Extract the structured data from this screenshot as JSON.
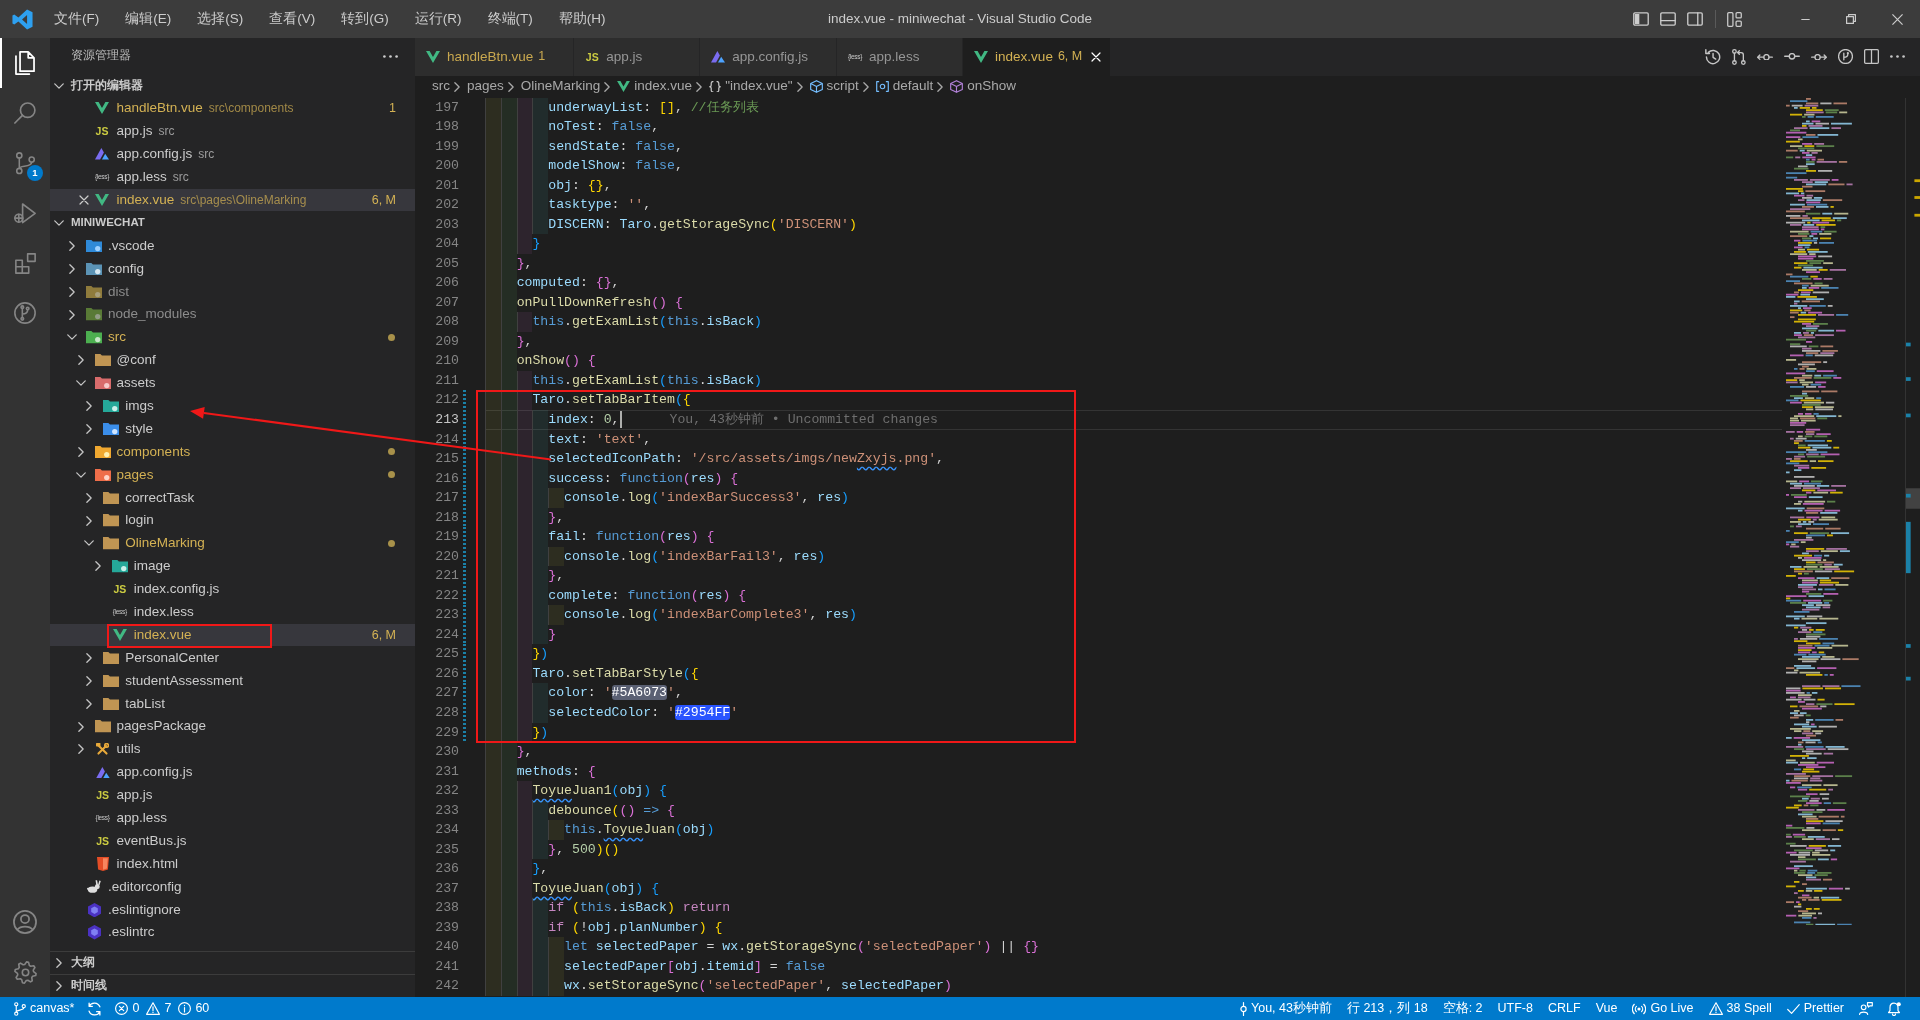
{
  "window": {
    "title": "index.vue - miniwechat - Visual Studio Code"
  },
  "menu": [
    "文件(F)",
    "编辑(E)",
    "选择(S)",
    "查看(V)",
    "转到(G)",
    "运行(R)",
    "终端(T)",
    "帮助(H)"
  ],
  "layout_controls": [
    {
      "kind": "sidebar"
    },
    {
      "kind": "panel"
    },
    {
      "kind": "auxbar"
    },
    {
      "kind": "customize"
    }
  ],
  "window_controls": [
    {
      "kind": "minimize"
    },
    {
      "kind": "restore"
    },
    {
      "kind": "close"
    }
  ],
  "activity_bar": {
    "top": [
      {
        "kind": "explorer",
        "selected": true
      },
      {
        "kind": "search",
        "selected": false
      },
      {
        "kind": "scm",
        "selected": false,
        "badge": "1"
      },
      {
        "kind": "debug",
        "selected": false
      },
      {
        "kind": "extensions",
        "selected": false
      },
      {
        "kind": "gitgraph",
        "selected": false
      }
    ],
    "bottom": [
      {
        "kind": "account"
      },
      {
        "kind": "settings"
      }
    ]
  },
  "sidebar": {
    "title": "资源管理器",
    "open_editors": {
      "title": "打开的编辑器",
      "expanded": true,
      "items": [
        {
          "label": "handleBtn.vue",
          "path": "src\\components",
          "badge": "1",
          "kind": "vue",
          "warning": true,
          "selected": false
        },
        {
          "label": "app.js",
          "path": "src",
          "kind": "js",
          "icon_text": "JS",
          "warning": false,
          "selected": false
        },
        {
          "label": "app.config.js",
          "path": "src",
          "kind": "appconfig",
          "warning": false,
          "selected": false
        },
        {
          "label": "app.less",
          "path": "src",
          "kind": "less",
          "icon_text": "{less}",
          "warning": false,
          "selected": false
        },
        {
          "label": "index.vue",
          "path": "src\\pages\\OlineMarking",
          "badge": "6, M",
          "kind": "vue",
          "warning": true,
          "selected": true
        }
      ]
    },
    "folder": {
      "title": "MINIWECHAT",
      "expanded": true,
      "items": [
        {
          "label": ".vscode",
          "kind": "vscode",
          "expanded": false,
          "modified": false,
          "ignored": false,
          "selected": false
        },
        {
          "label": "config",
          "kind": "config",
          "expanded": false,
          "modified": false,
          "ignored": false,
          "selected": false
        },
        {
          "label": "dist",
          "kind": "dist",
          "expanded": false,
          "modified": false,
          "ignored": true,
          "selected": false
        },
        {
          "label": "node_modules",
          "kind": "node",
          "expanded": false,
          "modified": false,
          "ignored": true,
          "selected": false
        },
        {
          "label": "src",
          "kind": "src",
          "expanded": true,
          "modified": true,
          "ignored": false,
          "selected": false,
          "children": [
            {
              "label": "@conf",
              "kind": "folder",
              "expanded": false,
              "modified": false,
              "ignored": false,
              "selected": false
            },
            {
              "label": "assets",
              "kind": "assets",
              "expanded": true,
              "modified": false,
              "ignored": false,
              "selected": false,
              "children": [
                {
                  "label": "imgs",
                  "kind": "images",
                  "expanded": false,
                  "modified": false,
                  "ignored": false,
                  "selected": false
                },
                {
                  "label": "style",
                  "kind": "style",
                  "expanded": false,
                  "modified": false,
                  "ignored": false,
                  "selected": false
                }
              ]
            },
            {
              "label": "components",
              "kind": "components",
              "expanded": false,
              "modified": true,
              "ignored": false,
              "selected": false
            },
            {
              "label": "pages",
              "kind": "pages",
              "expanded": true,
              "modified": true,
              "ignored": false,
              "selected": false,
              "children": [
                {
                  "label": "correctTask",
                  "kind": "folder",
                  "expanded": false,
                  "modified": false,
                  "ignored": false,
                  "selected": false
                },
                {
                  "label": "login",
                  "kind": "folder",
                  "expanded": false,
                  "modified": false,
                  "ignored": false,
                  "selected": false
                },
                {
                  "label": "OlineMarking",
                  "kind": "folder",
                  "expanded": true,
                  "modified": true,
                  "ignored": false,
                  "selected": false,
                  "children": [
                    {
                      "label": "image",
                      "kind": "images",
                      "expanded": false,
                      "modified": false,
                      "ignored": false,
                      "selected": false
                    },
                    {
                      "label": "index.config.js",
                      "kind": "js",
                      "icon_text": "JS",
                      "modified": false,
                      "ignored": false,
                      "selected": false
                    },
                    {
                      "label": "index.less",
                      "kind": "less",
                      "icon_text": "{less}",
                      "modified": false,
                      "ignored": false,
                      "selected": false
                    },
                    {
                      "label": "index.vue",
                      "kind": "vue",
                      "badge": "6, M",
                      "modified": true,
                      "ignored": false,
                      "selected": true
                    }
                  ]
                },
                {
                  "label": "PersonalCenter",
                  "kind": "folder",
                  "expanded": false,
                  "modified": false,
                  "ignored": false,
                  "selected": false
                },
                {
                  "label": "studentAssessment",
                  "kind": "folder",
                  "expanded": false,
                  "modified": false,
                  "ignored": false,
                  "selected": false
                },
                {
                  "label": "tabList",
                  "kind": "folder",
                  "expanded": false,
                  "modified": false,
                  "ignored": false,
                  "selected": false
                }
              ]
            },
            {
              "label": "pagesPackage",
              "kind": "folder",
              "expanded": false,
              "modified": false,
              "ignored": false,
              "selected": false
            },
            {
              "label": "utils",
              "kind": "utils",
              "expanded": false,
              "modified": false,
              "ignored": false,
              "selected": false
            },
            {
              "label": "app.config.js",
              "kind": "appconfig",
              "modified": false,
              "ignored": false,
              "selected": false
            },
            {
              "label": "app.js",
              "kind": "js",
              "icon_text": "JS",
              "modified": false,
              "ignored": false,
              "selected": false
            },
            {
              "label": "app.less",
              "kind": "less",
              "icon_text": "{less}",
              "modified": false,
              "ignored": false,
              "selected": false
            },
            {
              "label": "eventBus.js",
              "kind": "js",
              "icon_text": "JS",
              "modified": false,
              "ignored": false,
              "selected": false
            },
            {
              "label": "index.html",
              "kind": "html",
              "modified": false,
              "ignored": false,
              "selected": false
            }
          ]
        },
        {
          "label": ".editorconfig",
          "kind": "editorconfig",
          "modified": false,
          "ignored": false,
          "selected": false
        },
        {
          "label": ".eslintignore",
          "kind": "eslint",
          "modified": false,
          "ignored": false,
          "selected": false
        },
        {
          "label": ".eslintrc",
          "kind": "eslint",
          "modified": false,
          "ignored": false,
          "selected": false
        }
      ]
    },
    "panels": [
      {
        "title": "大纲",
        "expanded": false
      },
      {
        "title": "时间线",
        "expanded": false
      }
    ]
  },
  "editor": {
    "tabs": [
      {
        "label": "handleBtn.vue",
        "kind": "vue",
        "badge": "1",
        "warning": true,
        "selected": false
      },
      {
        "label": "app.js",
        "kind": "js",
        "icon_text": "JS",
        "warning": false,
        "selected": false
      },
      {
        "label": "app.config.js",
        "kind": "appconfig",
        "warning": false,
        "selected": false
      },
      {
        "label": "app.less",
        "kind": "less",
        "icon_text": "{less}",
        "warning": false,
        "selected": false
      },
      {
        "label": "index.vue",
        "kind": "vue",
        "badge": "6, M",
        "warning": true,
        "selected": true
      }
    ],
    "actions": [
      {
        "kind": "history"
      },
      {
        "kind": "compare"
      },
      {
        "kind": "prevchange"
      },
      {
        "kind": "commit"
      },
      {
        "kind": "nextchange"
      },
      {
        "kind": "gitlens"
      },
      {
        "kind": "split"
      },
      {
        "kind": "more"
      }
    ],
    "breadcrumb": [
      {
        "text": "src",
        "kind": "folder"
      },
      {
        "text": "pages",
        "kind": "folder"
      },
      {
        "text": "OlineMarking",
        "kind": "folder"
      },
      {
        "text": "index.vue",
        "kind": "vue"
      },
      {
        "text": "\"index.vue\"",
        "kind": "object"
      },
      {
        "text": "script",
        "kind": "module"
      },
      {
        "text": "default",
        "kind": "variable"
      },
      {
        "text": "onShow",
        "kind": "method"
      }
    ],
    "lines": [
      {
        "number": "197",
        "modified": false,
        "current": false,
        "tokens": [
          {
            "text": "        underwayList",
            "kind": "prop"
          },
          {
            "text": ": ",
            "kind": "plain"
          },
          {
            "text": "[]",
            "kind": "bracket1"
          },
          {
            "text": ", ",
            "kind": "plain"
          },
          {
            "text": "//任务列表",
            "kind": "comment"
          }
        ]
      },
      {
        "number": "198",
        "modified": false,
        "current": false,
        "tokens": [
          {
            "text": "        noTest",
            "kind": "prop"
          },
          {
            "text": ": ",
            "kind": "plain"
          },
          {
            "text": "false",
            "kind": "keyword"
          },
          {
            "text": ",",
            "kind": "plain"
          }
        ]
      },
      {
        "number": "199",
        "modified": false,
        "current": false,
        "tokens": [
          {
            "text": "        sendState",
            "kind": "prop"
          },
          {
            "text": ": ",
            "kind": "plain"
          },
          {
            "text": "false",
            "kind": "keyword"
          },
          {
            "text": ",",
            "kind": "plain"
          }
        ]
      },
      {
        "number": "200",
        "modified": false,
        "current": false,
        "tokens": [
          {
            "text": "        modelShow",
            "kind": "prop"
          },
          {
            "text": ": ",
            "kind": "plain"
          },
          {
            "text": "false",
            "kind": "keyword"
          },
          {
            "text": ",",
            "kind": "plain"
          }
        ]
      },
      {
        "number": "201",
        "modified": false,
        "current": false,
        "tokens": [
          {
            "text": "        obj",
            "kind": "prop"
          },
          {
            "text": ": ",
            "kind": "plain"
          },
          {
            "text": "{}",
            "kind": "bracket1"
          },
          {
            "text": ",",
            "kind": "plain"
          }
        ]
      },
      {
        "number": "202",
        "modified": false,
        "current": false,
        "tokens": [
          {
            "text": "        tasktype",
            "kind": "prop"
          },
          {
            "text": ": ",
            "kind": "plain"
          },
          {
            "text": "''",
            "kind": "string"
          },
          {
            "text": ",",
            "kind": "plain"
          }
        ]
      },
      {
        "number": "203",
        "modified": false,
        "current": false,
        "tokens": [
          {
            "text": "        DISCERN",
            "kind": "prop"
          },
          {
            "text": ": ",
            "kind": "plain"
          },
          {
            "text": "Taro",
            "kind": "prop"
          },
          {
            "text": ".",
            "kind": "plain"
          },
          {
            "text": "getStorageSync",
            "kind": "func"
          },
          {
            "text": "(",
            "kind": "bracket1"
          },
          {
            "text": "'DISCERN'",
            "kind": "string"
          },
          {
            "text": ")",
            "kind": "bracket1"
          }
        ]
      },
      {
        "number": "204",
        "modified": false,
        "current": false,
        "tokens": [
          {
            "text": "      }",
            "kind": "bracket3"
          }
        ]
      },
      {
        "number": "205",
        "modified": false,
        "current": false,
        "tokens": [
          {
            "text": "    }",
            "kind": "bracket2"
          },
          {
            "text": ",",
            "kind": "plain"
          }
        ]
      },
      {
        "number": "206",
        "modified": false,
        "current": false,
        "tokens": [
          {
            "text": "    computed",
            "kind": "prop"
          },
          {
            "text": ": ",
            "kind": "plain"
          },
          {
            "text": "{}",
            "kind": "bracket2"
          },
          {
            "text": ",",
            "kind": "plain"
          }
        ]
      },
      {
        "number": "207",
        "modified": false,
        "current": false,
        "tokens": [
          {
            "text": "    onPullDownRefresh",
            "kind": "func"
          },
          {
            "text": "() {",
            "kind": "bracket2"
          }
        ]
      },
      {
        "number": "208",
        "modified": false,
        "current": false,
        "tokens": [
          {
            "text": "      this",
            "kind": "keyword"
          },
          {
            "text": ".",
            "kind": "plain"
          },
          {
            "text": "getExamList",
            "kind": "func"
          },
          {
            "text": "(",
            "kind": "bracket3"
          },
          {
            "text": "this",
            "kind": "keyword"
          },
          {
            "text": ".",
            "kind": "plain"
          },
          {
            "text": "isBack",
            "kind": "prop"
          },
          {
            "text": ")",
            "kind": "bracket3"
          }
        ]
      },
      {
        "number": "209",
        "modified": false,
        "current": false,
        "tokens": [
          {
            "text": "    }",
            "kind": "bracket2"
          },
          {
            "text": ",",
            "kind": "plain"
          }
        ]
      },
      {
        "number": "210",
        "modified": false,
        "current": false,
        "tokens": [
          {
            "text": "    onShow",
            "kind": "func"
          },
          {
            "text": "() {",
            "kind": "bracket2"
          }
        ]
      },
      {
        "number": "211",
        "modified": false,
        "current": false,
        "tokens": [
          {
            "text": "      this",
            "kind": "keyword"
          },
          {
            "text": ".",
            "kind": "plain"
          },
          {
            "text": "getExamList",
            "kind": "func"
          },
          {
            "text": "(",
            "kind": "bracket3"
          },
          {
            "text": "this",
            "kind": "keyword"
          },
          {
            "text": ".",
            "kind": "plain"
          },
          {
            "text": "isBack",
            "kind": "prop"
          },
          {
            "text": ")",
            "kind": "bracket3"
          }
        ]
      },
      {
        "number": "212",
        "modified": true,
        "current": false,
        "tokens": [
          {
            "text": "      Taro",
            "kind": "prop"
          },
          {
            "text": ".",
            "kind": "plain"
          },
          {
            "text": "setTabBarItem",
            "kind": "func"
          },
          {
            "text": "(",
            "kind": "bracket3"
          },
          {
            "text": "{",
            "kind": "bracket1"
          }
        ]
      },
      {
        "number": "213",
        "modified": true,
        "current": true,
        "blame": "You, 43秒钟前 • Uncommitted changes",
        "tokens": [
          {
            "text": "        index",
            "kind": "prop"
          },
          {
            "text": ": ",
            "kind": "plain"
          },
          {
            "text": "0",
            "kind": "number"
          },
          {
            "text": ",",
            "kind": "plain"
          }
        ]
      },
      {
        "number": "214",
        "modified": true,
        "current": false,
        "tokens": [
          {
            "text": "        text",
            "kind": "prop"
          },
          {
            "text": ": ",
            "kind": "plain"
          },
          {
            "text": "'text'",
            "kind": "string"
          },
          {
            "text": ",",
            "kind": "plain"
          }
        ]
      },
      {
        "number": "215",
        "modified": true,
        "current": false,
        "tokens": [
          {
            "text": "        selectedIconPath",
            "kind": "prop"
          },
          {
            "text": ": ",
            "kind": "plain"
          },
          {
            "text": "'/src/assets/imgs/new",
            "kind": "string"
          },
          {
            "text": "Zxyjs",
            "kind": "stringtypo"
          },
          {
            "text": ".png'",
            "kind": "string"
          },
          {
            "text": ",",
            "kind": "plain"
          }
        ]
      },
      {
        "number": "216",
        "modified": true,
        "current": false,
        "tokens": [
          {
            "text": "        success",
            "kind": "prop"
          },
          {
            "text": ": ",
            "kind": "plain"
          },
          {
            "text": "function",
            "kind": "keyword"
          },
          {
            "text": "(",
            "kind": "bracket2"
          },
          {
            "text": "res",
            "kind": "prop"
          },
          {
            "text": ") {",
            "kind": "bracket2"
          }
        ]
      },
      {
        "number": "217",
        "modified": true,
        "current": false,
        "tokens": [
          {
            "text": "          console",
            "kind": "prop"
          },
          {
            "text": ".",
            "kind": "plain"
          },
          {
            "text": "log",
            "kind": "func"
          },
          {
            "text": "(",
            "kind": "bracket3"
          },
          {
            "text": "'indexBarSuccess3'",
            "kind": "string"
          },
          {
            "text": ", ",
            "kind": "plain"
          },
          {
            "text": "res",
            "kind": "prop"
          },
          {
            "text": ")",
            "kind": "bracket3"
          }
        ]
      },
      {
        "number": "218",
        "modified": true,
        "current": false,
        "tokens": [
          {
            "text": "        }",
            "kind": "bracket2"
          },
          {
            "text": ",",
            "kind": "plain"
          }
        ]
      },
      {
        "number": "219",
        "modified": true,
        "current": false,
        "tokens": [
          {
            "text": "        fail",
            "kind": "prop"
          },
          {
            "text": ": ",
            "kind": "plain"
          },
          {
            "text": "function",
            "kind": "keyword"
          },
          {
            "text": "(",
            "kind": "bracket2"
          },
          {
            "text": "res",
            "kind": "prop"
          },
          {
            "text": ") {",
            "kind": "bracket2"
          }
        ]
      },
      {
        "number": "220",
        "modified": true,
        "current": false,
        "tokens": [
          {
            "text": "          console",
            "kind": "prop"
          },
          {
            "text": ".",
            "kind": "plain"
          },
          {
            "text": "log",
            "kind": "func"
          },
          {
            "text": "(",
            "kind": "bracket3"
          },
          {
            "text": "'indexBarFail3'",
            "kind": "string"
          },
          {
            "text": ", ",
            "kind": "plain"
          },
          {
            "text": "res",
            "kind": "prop"
          },
          {
            "text": ")",
            "kind": "bracket3"
          }
        ]
      },
      {
        "number": "221",
        "modified": true,
        "current": false,
        "tokens": [
          {
            "text": "        }",
            "kind": "bracket2"
          },
          {
            "text": ",",
            "kind": "plain"
          }
        ]
      },
      {
        "number": "222",
        "modified": true,
        "current": false,
        "tokens": [
          {
            "text": "        complete",
            "kind": "prop"
          },
          {
            "text": ": ",
            "kind": "plain"
          },
          {
            "text": "function",
            "kind": "keyword"
          },
          {
            "text": "(",
            "kind": "bracket2"
          },
          {
            "text": "res",
            "kind": "prop"
          },
          {
            "text": ") {",
            "kind": "bracket2"
          }
        ]
      },
      {
        "number": "223",
        "modified": true,
        "current": false,
        "tokens": [
          {
            "text": "          console",
            "kind": "prop"
          },
          {
            "text": ".",
            "kind": "plain"
          },
          {
            "text": "log",
            "kind": "func"
          },
          {
            "text": "(",
            "kind": "bracket3"
          },
          {
            "text": "'indexBarComplete3'",
            "kind": "string"
          },
          {
            "text": ", ",
            "kind": "plain"
          },
          {
            "text": "res",
            "kind": "prop"
          },
          {
            "text": ")",
            "kind": "bracket3"
          }
        ]
      },
      {
        "number": "224",
        "modified": true,
        "current": false,
        "tokens": [
          {
            "text": "        }",
            "kind": "bracket2"
          }
        ]
      },
      {
        "number": "225",
        "modified": true,
        "current": false,
        "tokens": [
          {
            "text": "      }",
            "kind": "bracket1"
          },
          {
            "text": ")",
            "kind": "bracket3"
          }
        ]
      },
      {
        "number": "226",
        "modified": true,
        "current": false,
        "tokens": [
          {
            "text": "      Taro",
            "kind": "prop"
          },
          {
            "text": ".",
            "kind": "plain"
          },
          {
            "text": "setTabBarStyle",
            "kind": "func"
          },
          {
            "text": "(",
            "kind": "bracket3"
          },
          {
            "text": "{",
            "kind": "bracket1"
          }
        ]
      },
      {
        "number": "227",
        "modified": true,
        "current": false,
        "tokens": [
          {
            "text": "        color",
            "kind": "prop"
          },
          {
            "text": ": ",
            "kind": "plain"
          },
          {
            "text": "'",
            "kind": "string"
          },
          {
            "text": "#5A6073",
            "kind": "swatch",
            "color": "#5a6073"
          },
          {
            "text": "'",
            "kind": "string"
          },
          {
            "text": ",",
            "kind": "plain"
          }
        ]
      },
      {
        "number": "228",
        "modified": true,
        "current": false,
        "tokens": [
          {
            "text": "        selectedColor",
            "kind": "prop"
          },
          {
            "text": ": ",
            "kind": "plain"
          },
          {
            "text": "'",
            "kind": "string"
          },
          {
            "text": "#2954FF",
            "kind": "swatch",
            "color": "#2954ff"
          },
          {
            "text": "'",
            "kind": "string"
          }
        ]
      },
      {
        "number": "229",
        "modified": true,
        "current": false,
        "tokens": [
          {
            "text": "      }",
            "kind": "bracket1"
          },
          {
            "text": ")",
            "kind": "bracket3"
          }
        ]
      },
      {
        "number": "230",
        "modified": false,
        "current": false,
        "tokens": [
          {
            "text": "    }",
            "kind": "bracket2"
          },
          {
            "text": ",",
            "kind": "plain"
          }
        ]
      },
      {
        "number": "231",
        "modified": false,
        "current": false,
        "tokens": [
          {
            "text": "    methods",
            "kind": "prop"
          },
          {
            "text": ": ",
            "kind": "plain"
          },
          {
            "text": "{",
            "kind": "bracket2"
          }
        ]
      },
      {
        "number": "232",
        "modified": false,
        "current": false,
        "tokens": [
          {
            "text": "      Toyue",
            "kind": "functypo"
          },
          {
            "text": "Juan1",
            "kind": "func"
          },
          {
            "text": "(",
            "kind": "bracket3"
          },
          {
            "text": "obj",
            "kind": "prop"
          },
          {
            "text": ") {",
            "kind": "bracket3"
          }
        ]
      },
      {
        "number": "233",
        "modified": false,
        "current": false,
        "tokens": [
          {
            "text": "        debounce",
            "kind": "func"
          },
          {
            "text": "(",
            "kind": "bracket1"
          },
          {
            "text": "()",
            "kind": "bracket2"
          },
          {
            "text": " => ",
            "kind": "keyword"
          },
          {
            "text": "{",
            "kind": "bracket2"
          }
        ]
      },
      {
        "number": "234",
        "modified": false,
        "current": false,
        "tokens": [
          {
            "text": "          this",
            "kind": "keyword"
          },
          {
            "text": ".",
            "kind": "plain"
          },
          {
            "text": "Toyue",
            "kind": "functypo"
          },
          {
            "text": "Juan",
            "kind": "func"
          },
          {
            "text": "(",
            "kind": "bracket3"
          },
          {
            "text": "obj",
            "kind": "prop"
          },
          {
            "text": ")",
            "kind": "bracket3"
          }
        ]
      },
      {
        "number": "235",
        "modified": false,
        "current": false,
        "tokens": [
          {
            "text": "        }",
            "kind": "bracket2"
          },
          {
            "text": ", ",
            "kind": "plain"
          },
          {
            "text": "500",
            "kind": "number"
          },
          {
            "text": ")()",
            "kind": "bracket1"
          }
        ]
      },
      {
        "number": "236",
        "modified": false,
        "current": false,
        "tokens": [
          {
            "text": "      }",
            "kind": "bracket3"
          },
          {
            "text": ",",
            "kind": "plain"
          }
        ]
      },
      {
        "number": "237",
        "modified": false,
        "current": false,
        "tokens": [
          {
            "text": "      Toyue",
            "kind": "functypo"
          },
          {
            "text": "Juan",
            "kind": "func"
          },
          {
            "text": "(",
            "kind": "bracket3"
          },
          {
            "text": "obj",
            "kind": "prop"
          },
          {
            "text": ") {",
            "kind": "bracket3"
          }
        ]
      },
      {
        "number": "238",
        "modified": false,
        "current": false,
        "tokens": [
          {
            "text": "        if",
            "kind": "control"
          },
          {
            "text": " (",
            "kind": "bracket1"
          },
          {
            "text": "this",
            "kind": "keyword"
          },
          {
            "text": ".",
            "kind": "plain"
          },
          {
            "text": "isBack",
            "kind": "prop"
          },
          {
            "text": ") ",
            "kind": "bracket1"
          },
          {
            "text": "return",
            "kind": "control"
          }
        ]
      },
      {
        "number": "239",
        "modified": false,
        "current": false,
        "tokens": [
          {
            "text": "        if",
            "kind": "control"
          },
          {
            "text": " (",
            "kind": "bracket1"
          },
          {
            "text": "!",
            "kind": "plain"
          },
          {
            "text": "obj",
            "kind": "prop"
          },
          {
            "text": ".",
            "kind": "plain"
          },
          {
            "text": "planNumber",
            "kind": "prop"
          },
          {
            "text": ") {",
            "kind": "bracket1"
          }
        ]
      },
      {
        "number": "240",
        "modified": false,
        "current": false,
        "tokens": [
          {
            "text": "          let ",
            "kind": "keyword"
          },
          {
            "text": "selectedPaper",
            "kind": "prop"
          },
          {
            "text": " = ",
            "kind": "plain"
          },
          {
            "text": "wx",
            "kind": "prop"
          },
          {
            "text": ".",
            "kind": "plain"
          },
          {
            "text": "getStorageSync",
            "kind": "func"
          },
          {
            "text": "(",
            "kind": "bracket2"
          },
          {
            "text": "'selectedPaper'",
            "kind": "string"
          },
          {
            "text": ")",
            "kind": "bracket2"
          },
          {
            "text": " || ",
            "kind": "plain"
          },
          {
            "text": "{}",
            "kind": "bracket2"
          }
        ]
      },
      {
        "number": "241",
        "modified": false,
        "current": false,
        "tokens": [
          {
            "text": "          selectedPaper",
            "kind": "prop"
          },
          {
            "text": "[",
            "kind": "bracket2"
          },
          {
            "text": "obj",
            "kind": "prop"
          },
          {
            "text": ".",
            "kind": "plain"
          },
          {
            "text": "itemid",
            "kind": "prop"
          },
          {
            "text": "]",
            "kind": "bracket2"
          },
          {
            "text": " = ",
            "kind": "plain"
          },
          {
            "text": "false",
            "kind": "keyword"
          }
        ]
      },
      {
        "number": "242",
        "modified": false,
        "current": false,
        "tokens": [
          {
            "text": "          wx",
            "kind": "prop"
          },
          {
            "text": ".",
            "kind": "plain"
          },
          {
            "text": "setStorageSync",
            "kind": "func"
          },
          {
            "text": "(",
            "kind": "bracket2"
          },
          {
            "text": "'selectedPaper'",
            "kind": "string"
          },
          {
            "text": ", ",
            "kind": "plain"
          },
          {
            "text": "selectedPaper",
            "kind": "prop"
          },
          {
            "text": ")",
            "kind": "bracket2"
          }
        ]
      }
    ]
  },
  "status_bar": {
    "left": [
      {
        "kind": "branch",
        "text": "canvas*"
      },
      {
        "kind": "sync"
      },
      {
        "kind": "problems",
        "errors": "0",
        "warnings": "7",
        "infos": "60"
      }
    ],
    "right": [
      {
        "kind": "blame",
        "text": "You, 43秒钟前"
      },
      {
        "kind": "position",
        "text": "行 213，列 18"
      },
      {
        "kind": "indentation",
        "text": "空格: 2"
      },
      {
        "kind": "encoding",
        "text": "UTF-8"
      },
      {
        "kind": "eol",
        "text": "CRLF"
      },
      {
        "kind": "language",
        "text": "Vue"
      },
      {
        "kind": "golive",
        "text": "Go Live"
      },
      {
        "kind": "spell",
        "text": "38 Spell"
      },
      {
        "kind": "prettier",
        "text": "Prettier"
      },
      {
        "kind": "feedback"
      },
      {
        "kind": "bell"
      }
    ]
  }
}
